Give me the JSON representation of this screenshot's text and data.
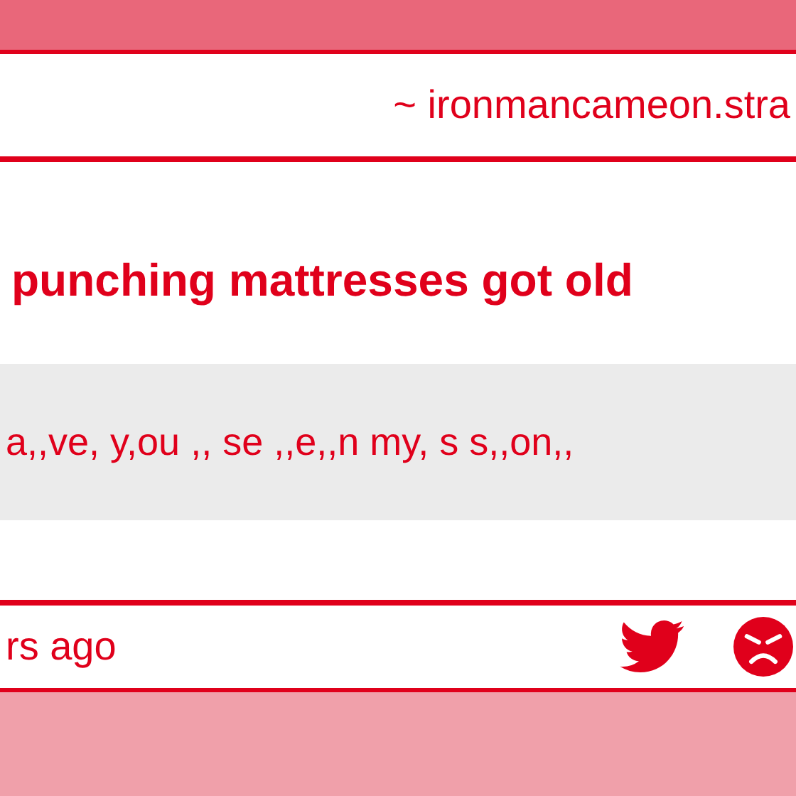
{
  "header": {
    "blog": "~ ironmancameon.stra"
  },
  "post": {
    "title": "punching mattresses got old",
    "quote": "a,,ve, y,ou ,, se ,,e,,n my, s s,,on,,"
  },
  "footer": {
    "time": "rs ago"
  }
}
